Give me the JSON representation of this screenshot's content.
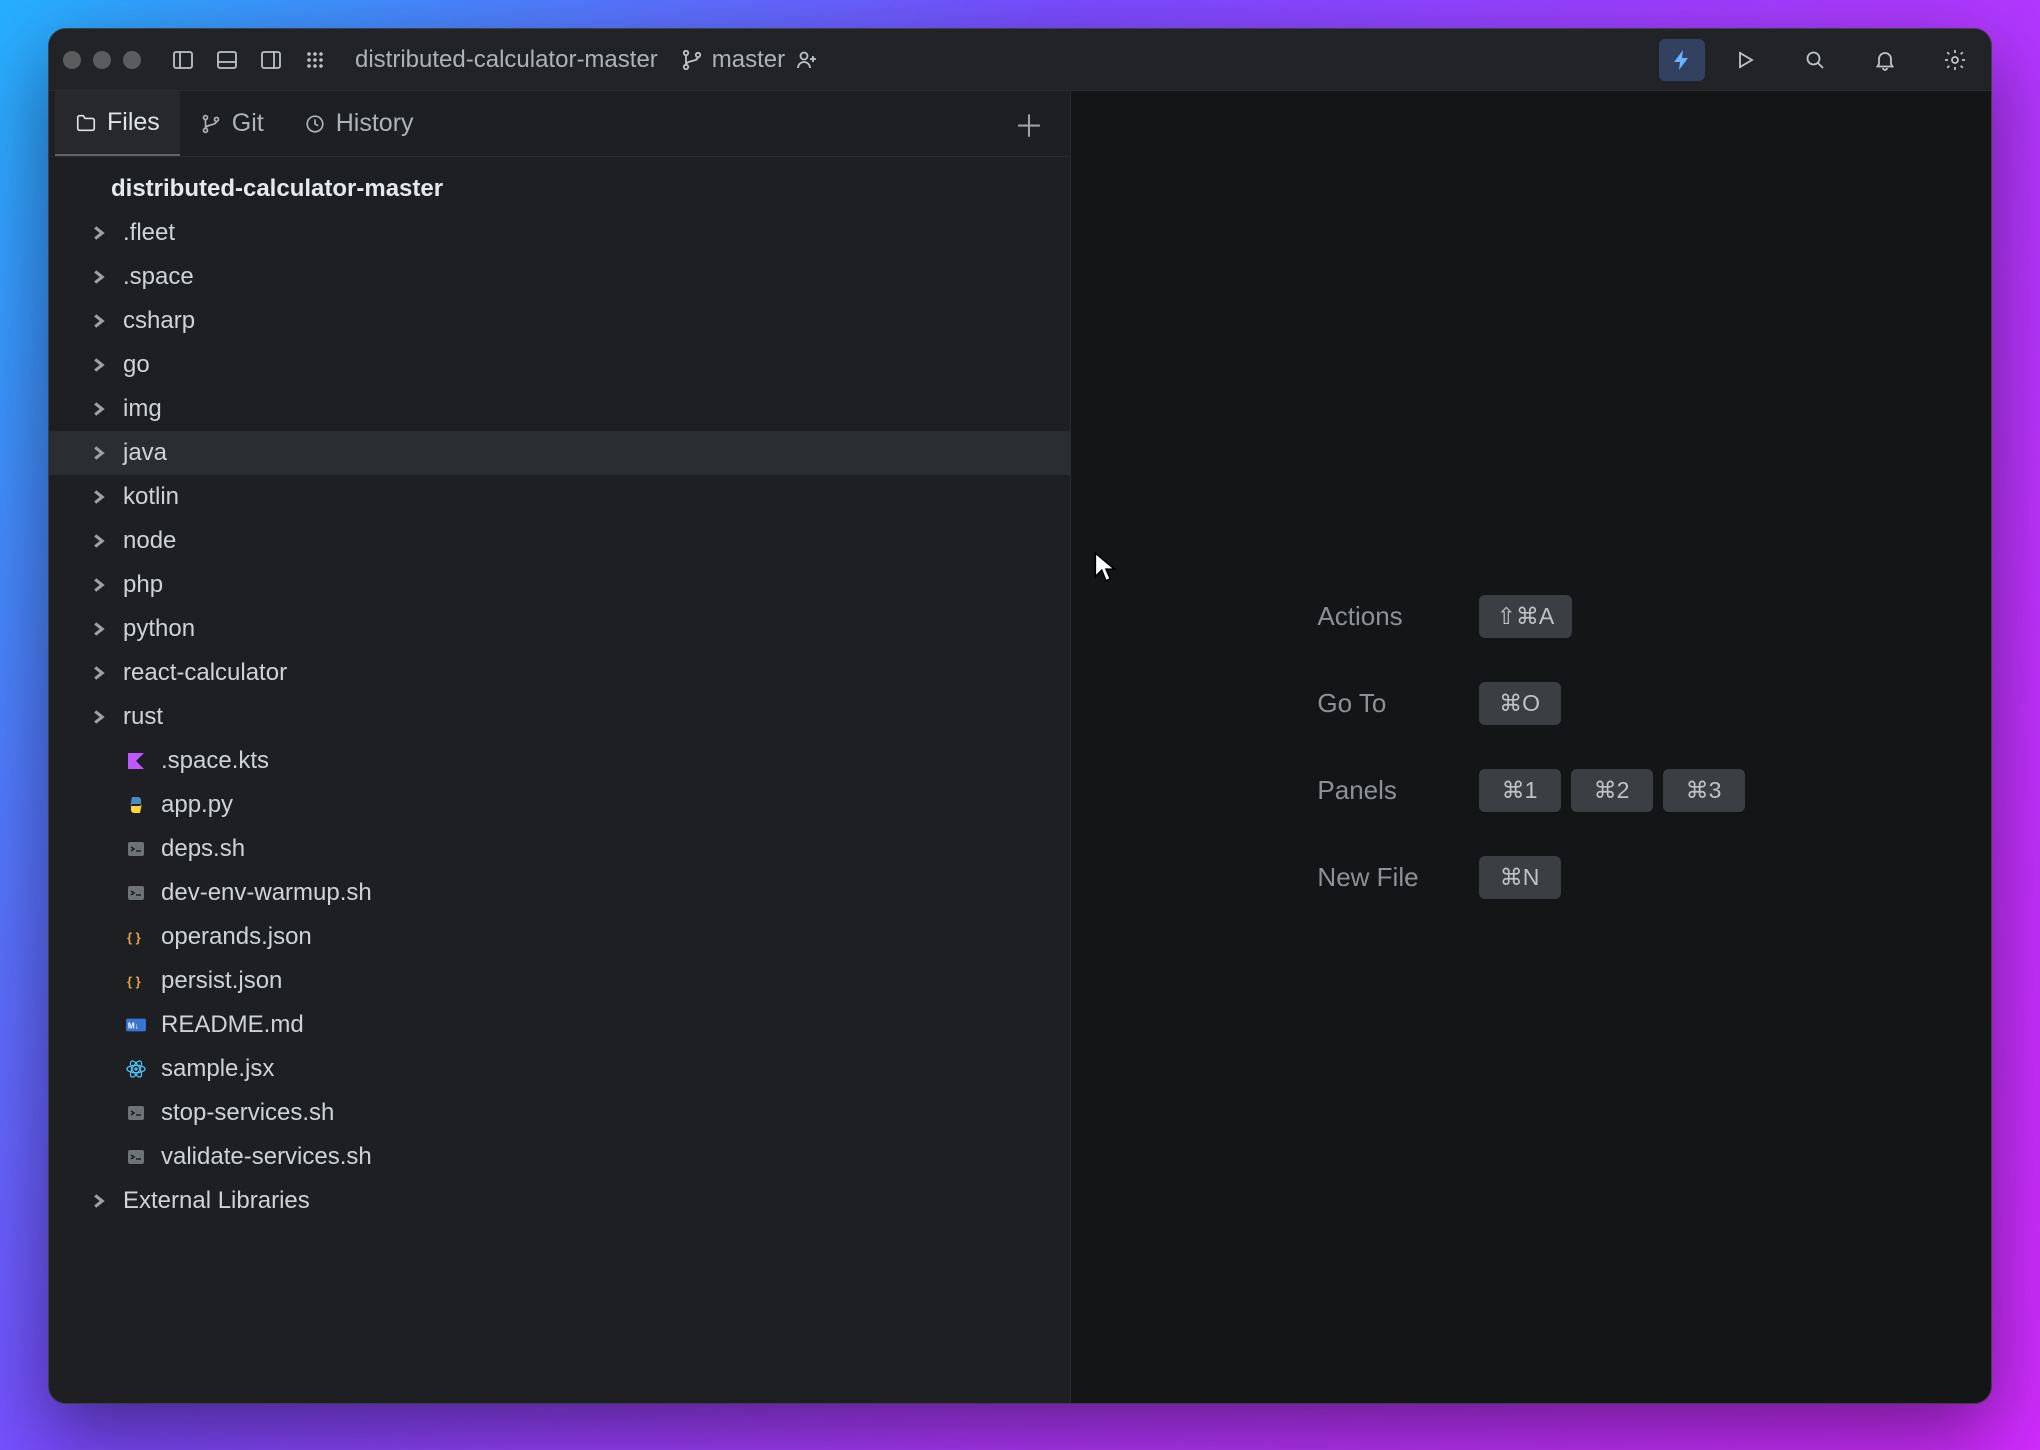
{
  "titlebar": {
    "project": "distributed-calculator-master",
    "branch": "master"
  },
  "tabs": {
    "files": "Files",
    "git": "Git",
    "history": "History"
  },
  "tree": {
    "root": "distributed-calculator-master",
    "folders": [
      ".fleet",
      ".space",
      "csharp",
      "go",
      "img",
      "java",
      "kotlin",
      "node",
      "php",
      "python",
      "react-calculator",
      "rust"
    ],
    "hover": "java",
    "files": [
      {
        "name": ".space.kts",
        "icon": "kotlin"
      },
      {
        "name": "app.py",
        "icon": "python"
      },
      {
        "name": "deps.sh",
        "icon": "shell"
      },
      {
        "name": "dev-env-warmup.sh",
        "icon": "shell"
      },
      {
        "name": "operands.json",
        "icon": "json"
      },
      {
        "name": "persist.json",
        "icon": "json"
      },
      {
        "name": "README.md",
        "icon": "md"
      },
      {
        "name": "sample.jsx",
        "icon": "react"
      },
      {
        "name": "stop-services.sh",
        "icon": "shell"
      },
      {
        "name": "validate-services.sh",
        "icon": "shell"
      }
    ],
    "external": "External Libraries"
  },
  "shortcuts": {
    "actions": {
      "label": "Actions",
      "keys": [
        "⇧⌘A"
      ]
    },
    "goto": {
      "label": "Go To",
      "keys": [
        "⌘O"
      ]
    },
    "panels": {
      "label": "Panels",
      "keys": [
        "⌘1",
        "⌘2",
        "⌘3"
      ]
    },
    "newfile": {
      "label": "New File",
      "keys": [
        "⌘N"
      ]
    }
  }
}
